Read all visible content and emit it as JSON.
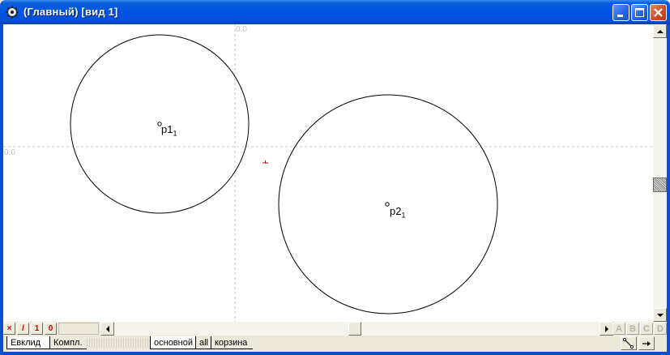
{
  "window": {
    "title": "(Главный)  [вид 1]",
    "controls": {
      "minimize": "minimize",
      "maximize": "maximize",
      "close": "close"
    }
  },
  "canvas": {
    "origin_label_x": "0.0",
    "origin_label_y": "0.0",
    "points": [
      {
        "name": "p1",
        "subscript": "1"
      },
      {
        "name": "p2",
        "subscript": "1"
      }
    ]
  },
  "bottom_bar": {
    "mode_buttons": [
      "×",
      "/",
      "1",
      "0"
    ],
    "layer_buttons": [
      "A",
      "B",
      "C",
      "D"
    ]
  },
  "tabs": {
    "left": [
      "Евклид",
      "Компл."
    ],
    "right": [
      "основной",
      "all",
      "корзина"
    ]
  },
  "colors": {
    "title_blue": "#0054e3",
    "canvas_bg": "#ffffff",
    "guide_line": "#c0c0c0",
    "mode_red": "#c00000"
  }
}
